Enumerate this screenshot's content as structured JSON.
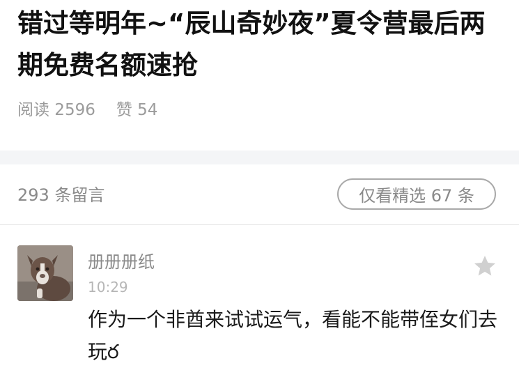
{
  "article": {
    "title": "错过等明年~“辰山奇妙夜”夏令营最后两期免费名额速抢",
    "reads": "阅读 2596",
    "likes": "赞 54"
  },
  "comments_header": {
    "count_label": "293 条留言",
    "filter_button": "仅看精选 67 条"
  },
  "comments": [
    {
      "author": "册册册纸",
      "time": "10:29",
      "text": "作为一个非酋来试试运气，看能不能带侄女们去玩ర",
      "avatar_icon": "dog-avatar",
      "like_icon": "star-icon"
    }
  ],
  "colors": {
    "title": "#111111",
    "meta": "#9b9b9b",
    "band": "#f4f5f7",
    "star": "#d0d0d0"
  }
}
